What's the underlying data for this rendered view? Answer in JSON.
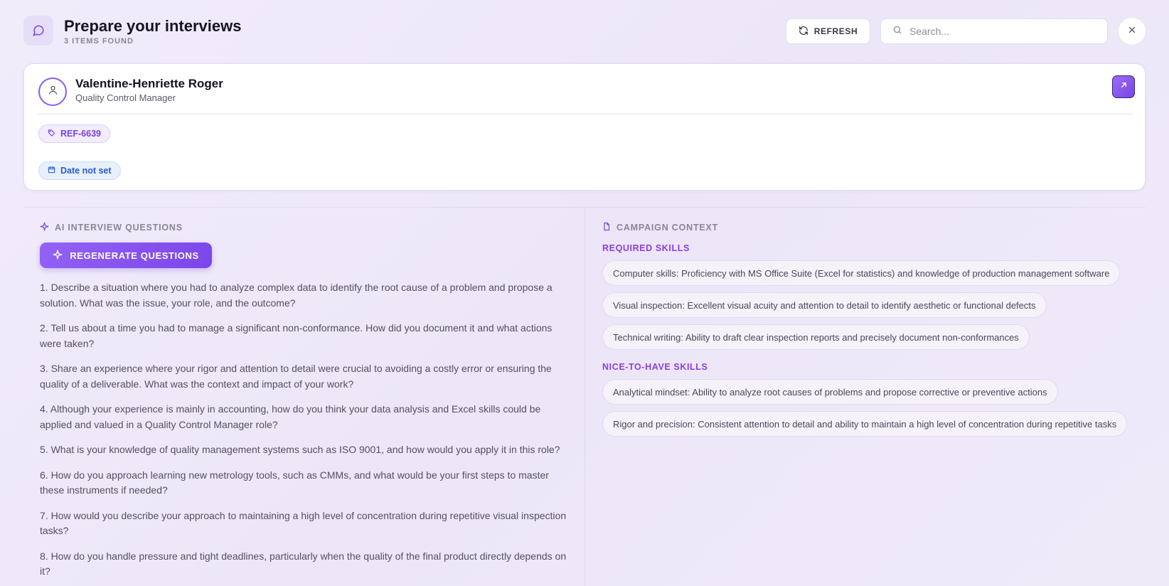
{
  "header": {
    "title": "Prepare your interviews",
    "items_found": "3 ITEMS FOUND",
    "refresh_label": "REFRESH",
    "search_placeholder": "Search..."
  },
  "candidate": {
    "name": "Valentine-Henriette Roger",
    "role": "Quality Control Manager",
    "ref": "REF-6639",
    "date": "Date not set"
  },
  "questions_panel": {
    "heading": "AI INTERVIEW QUESTIONS",
    "regenerate_label": "REGENERATE QUESTIONS",
    "questions": [
      "1. Describe a situation where you had to analyze complex data to identify the root cause of a problem and propose a solution. What was the issue, your role, and the outcome?",
      "2. Tell us about a time you had to manage a significant non-conformance. How did you document it and what actions were taken?",
      "3. Share an experience where your rigor and attention to detail were crucial to avoiding a costly error or ensuring the quality of a deliverable. What was the context and impact of your work?",
      "4. Although your experience is mainly in accounting, how do you think your data analysis and Excel skills could be applied and valued in a Quality Control Manager role?",
      "5. What is your knowledge of quality management systems such as ISO 9001, and how would you apply it in this role?",
      "6. How do you approach learning new metrology tools, such as CMMs, and what would be your first steps to master these instruments if needed?",
      "7. How would you describe your approach to maintaining a high level of concentration during repetitive visual inspection tasks?",
      "8. How do you handle pressure and tight deadlines, particularly when the quality of the final product directly depends on it?"
    ]
  },
  "campaign_panel": {
    "heading": "CAMPAIGN CONTEXT",
    "required_label": "REQUIRED SKILLS",
    "required_skills": [
      "Computer skills: Proficiency with MS Office Suite (Excel for statistics) and knowledge of production management software",
      "Visual inspection: Excellent visual acuity and attention to detail to identify aesthetic or functional defects",
      "Technical writing: Ability to draft clear inspection reports and precisely document non-conformances"
    ],
    "nice_label": "NICE-TO-HAVE SKILLS",
    "nice_skills": [
      "Analytical mindset: Ability to analyze root causes of problems and propose corrective or preventive actions",
      "Rigor and precision: Consistent attention to detail and ability to maintain a high level of concentration during repetitive tasks"
    ]
  },
  "icons": {
    "app": "chat-bubble-icon",
    "refresh": "refresh-icon",
    "search": "search-icon",
    "close": "close-icon",
    "avatar": "user-icon",
    "open": "arrow-up-right-icon",
    "ref": "tag-icon",
    "date": "calendar-icon",
    "ai": "sparkle-icon",
    "campaign": "document-icon"
  },
  "colors": {
    "accent": "#7b45e8",
    "ref_tag": "#7a3fe0",
    "date_tag": "#2b5bc9"
  }
}
